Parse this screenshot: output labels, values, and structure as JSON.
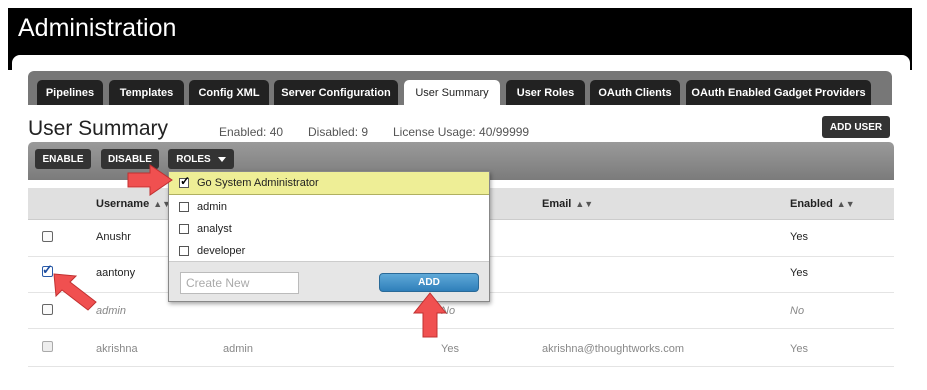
{
  "app": {
    "title": "Administration"
  },
  "tabs": [
    {
      "label": "Pipelines"
    },
    {
      "label": "Templates"
    },
    {
      "label": "Config XML"
    },
    {
      "label": "Server Configuration"
    },
    {
      "label": "User Summary",
      "active": true
    },
    {
      "label": "User Roles"
    },
    {
      "label": "OAuth Clients"
    },
    {
      "label": "OAuth Enabled Gadget Providers"
    }
  ],
  "summary": {
    "title": "User Summary",
    "enabled": "Enabled: 40",
    "disabled": "Disabled: 9",
    "license": "License Usage: 40/99999",
    "add_user_label": "ADD USER"
  },
  "toolbar": {
    "enable_label": "ENABLE",
    "disable_label": "DISABLE",
    "roles_label": "ROLES"
  },
  "table": {
    "columns": [
      "Username",
      "Email",
      "Enabled"
    ],
    "rows": [
      {
        "username": "Anushr",
        "roles": "",
        "admin": "",
        "email": "",
        "enabled": "Yes",
        "checked": false,
        "style": "normal"
      },
      {
        "username": "aantony",
        "roles": "",
        "admin": "",
        "email": "",
        "enabled": "Yes",
        "checked": true,
        "style": "normal"
      },
      {
        "username": "admin",
        "roles": "",
        "admin": "No",
        "email": "",
        "enabled": "No",
        "checked": false,
        "style": "italic"
      },
      {
        "username": "akrishna",
        "roles": "admin",
        "admin": "Yes",
        "email": "akrishna@thoughtworks.com",
        "enabled": "Yes",
        "checked": false,
        "style": "muted"
      }
    ]
  },
  "roles_dropdown": {
    "items": [
      {
        "label": "Go System Administrator",
        "checked": true,
        "selected": true
      },
      {
        "label": "admin",
        "checked": false
      },
      {
        "label": "analyst",
        "checked": false
      },
      {
        "label": "developer",
        "checked": false
      }
    ],
    "create_placeholder": "Create New",
    "add_label": "ADD"
  },
  "colors": {
    "header": "#000000",
    "toolbar": "#8a8a8a",
    "selected_role": "#eeee96",
    "add_button": "#3f8fc8",
    "annotation_arrow": "#f05050"
  }
}
